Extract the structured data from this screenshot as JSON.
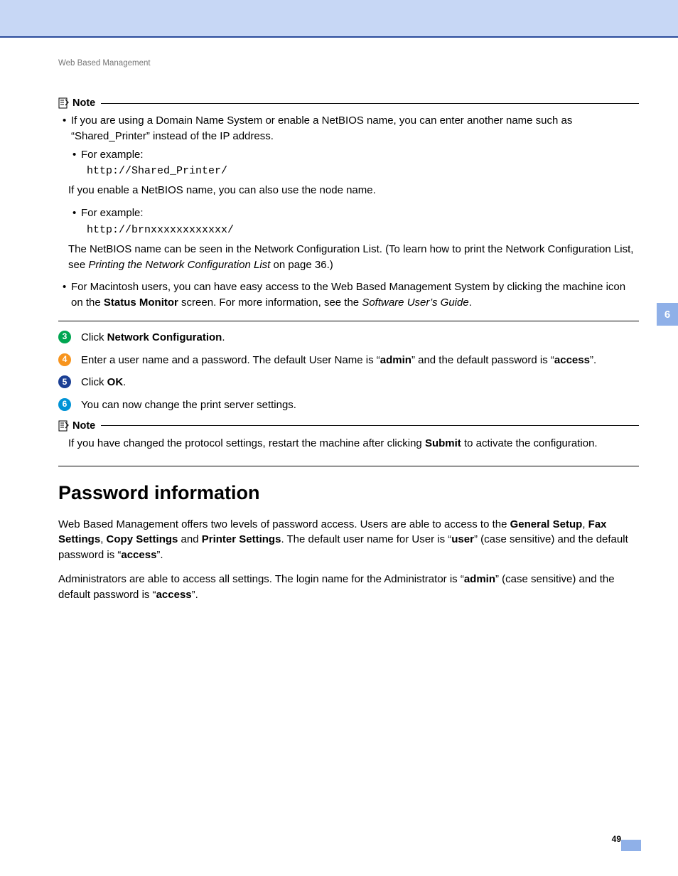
{
  "header": "Web Based Management",
  "note1": {
    "label": "Note",
    "bullet1": "If you are using a Domain Name System or enable a NetBIOS name, you can enter another name such as “Shared_Printer” instead of the IP address.",
    "forExample": "For example:",
    "code1": "http://Shared_Printer/",
    "netbiosLine": "If you enable a NetBIOS name, you can also use the node name.",
    "code2": "http://brnxxxxxxxxxxxx/",
    "netbiosList_a": "The NetBIOS name can be seen in the Network Configuration List. (To learn how to print the Network Configuration List, see ",
    "netbiosList_b": "Printing the Network Configuration List",
    "netbiosList_c": " on page 36.)",
    "mac_a": "For Macintosh users, you can have easy access to the Web Based Management System by clicking the machine icon on the ",
    "mac_b": "Status Monitor",
    "mac_c": " screen. For more information, see the ",
    "mac_d": "Software User’s Guide",
    "mac_e": "."
  },
  "steps": {
    "s3": {
      "num": "3",
      "a": "Click ",
      "b": "Network Configuration",
      "c": "."
    },
    "s4": {
      "num": "4",
      "a": "Enter a user name and a password. The default User Name is “",
      "b": "admin",
      "c": "” and the default password is “",
      "d": "access",
      "e": "”."
    },
    "s5": {
      "num": "5",
      "a": "Click ",
      "b": "OK",
      "c": "."
    },
    "s6": {
      "num": "6",
      "a": "You can now change the print server settings."
    }
  },
  "note2": {
    "label": "Note",
    "a": "If you have changed the protocol settings, restart the machine after clicking ",
    "b": "Submit",
    "c": " to activate the configuration."
  },
  "section": {
    "title": "Password information",
    "p1": {
      "a": "Web Based Management offers two levels of password access. Users are able to access to the ",
      "b": "General Setup",
      "c": ", ",
      "d": "Fax Settings",
      "e": ", ",
      "f": "Copy Settings",
      "g": " and ",
      "h": "Printer Settings",
      "i": ". The default user name for User is “",
      "j": "user",
      "k": "” (case sensitive) and the default password is “",
      "l": "access",
      "m": "”."
    },
    "p2": {
      "a": "Administrators are able to access all settings. The login name for the Administrator is “",
      "b": "admin",
      "c": "” (case sensitive) and the default password is “",
      "d": "access",
      "e": "”."
    }
  },
  "sideTab": "6",
  "pageNumber": "49"
}
